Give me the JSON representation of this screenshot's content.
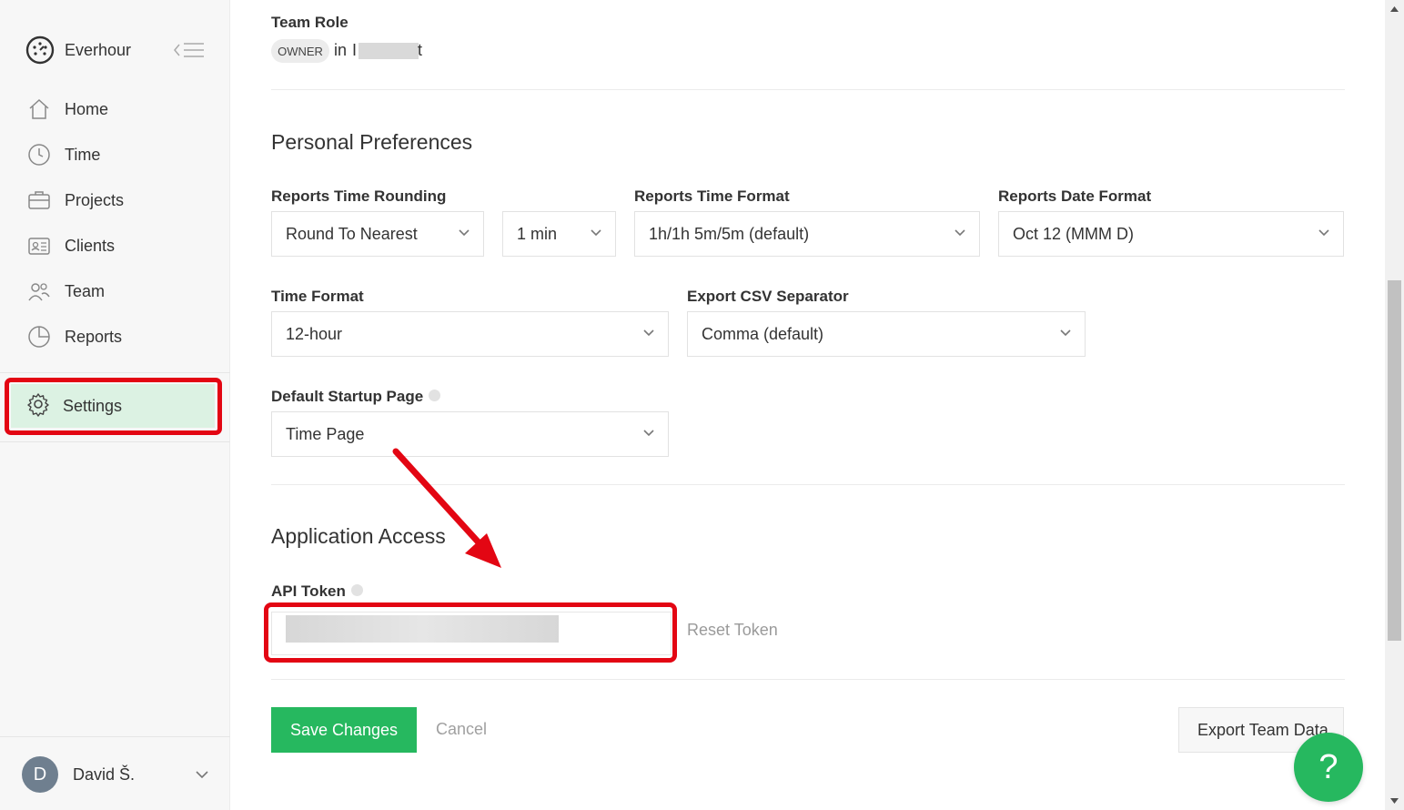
{
  "sidebar": {
    "brand_name": "Everhour",
    "nav_items": [
      {
        "label": "Home",
        "icon": "home-icon"
      },
      {
        "label": "Time",
        "icon": "clock-icon"
      },
      {
        "label": "Projects",
        "icon": "briefcase-icon"
      },
      {
        "label": "Clients",
        "icon": "clients-icon"
      },
      {
        "label": "Team",
        "icon": "team-icon"
      },
      {
        "label": "Reports",
        "icon": "pie-chart-icon"
      }
    ],
    "settings_label": "Settings",
    "user": {
      "initial": "D",
      "name": "David Š."
    }
  },
  "team_role": {
    "label": "Team Role",
    "badge": "OWNER",
    "in_text": "in",
    "team_name_start": "I",
    "team_name_end": "t"
  },
  "personal_preferences": {
    "heading": "Personal Preferences",
    "reports_time_rounding": {
      "label": "Reports Time Rounding",
      "value": "Round To Nearest",
      "step_value": "1 min"
    },
    "reports_time_format": {
      "label": "Reports Time Format",
      "value": "1h/1h 5m/5m (default)"
    },
    "reports_date_format": {
      "label": "Reports Date Format",
      "value": "Oct 12 (MMM D)"
    },
    "time_format": {
      "label": "Time Format",
      "value": "12-hour"
    },
    "export_csv_separator": {
      "label": "Export CSV Separator",
      "value": "Comma (default)"
    },
    "default_startup_page": {
      "label": "Default Startup Page",
      "value": "Time Page"
    }
  },
  "application_access": {
    "heading": "Application Access",
    "api_token_label": "API Token",
    "reset_token": "Reset Token"
  },
  "actions": {
    "save": "Save Changes",
    "cancel": "Cancel",
    "export": "Export Team Data",
    "help": "?"
  },
  "colors": {
    "accent_green": "#26b85f",
    "highlight_red": "#e30613",
    "settings_bg": "#dcf2e3"
  }
}
